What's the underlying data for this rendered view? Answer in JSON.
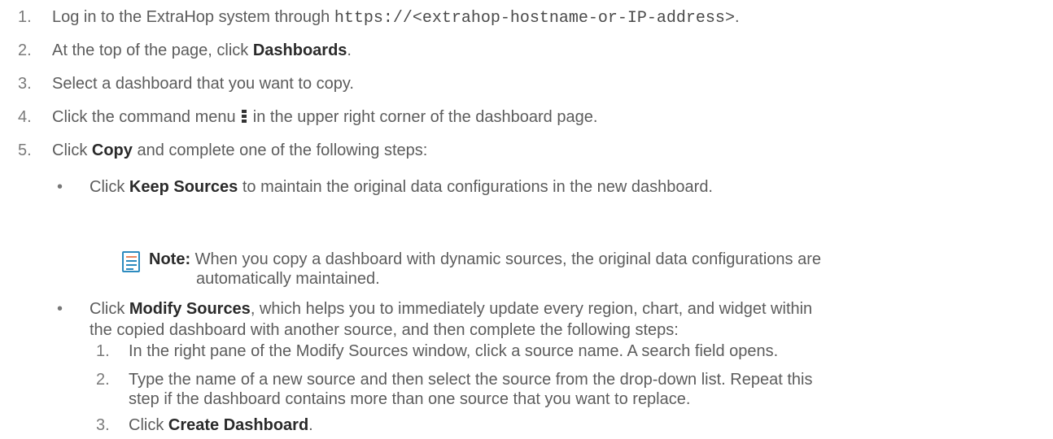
{
  "steps": [
    {
      "num": "1.",
      "pre": "Log in to the ExtraHop system through ",
      "code": "https://<extrahop-hostname-or-IP-address>",
      "post": "."
    },
    {
      "num": "2.",
      "pre": "At the top of the page, click ",
      "bold": "Dashboards",
      "post": "."
    },
    {
      "num": "3.",
      "text": "Select a dashboard that you want to copy."
    },
    {
      "num": "4.",
      "pre": "Click the command menu ",
      "post": " in the upper right corner of the dashboard page."
    },
    {
      "num": "5.",
      "pre": "Click ",
      "bold": "Copy",
      "post": " and complete one of the following steps:"
    }
  ],
  "bullets": {
    "keep": {
      "pre": "Click ",
      "bold": "Keep Sources",
      "post": " to maintain the original data configurations in the new dashboard."
    },
    "note": {
      "label": "Note:",
      "line1": " When you copy a dashboard with dynamic sources, the original data configurations are",
      "line2": "automatically maintained."
    },
    "modify": {
      "pre": "Click ",
      "bold": "Modify Sources",
      "post": ", which helps you to immediately update every region, chart, and widget within",
      "line2": "the copied dashboard with another source, and then complete the following steps:"
    }
  },
  "substeps": [
    {
      "num": "1.",
      "text": "In the right pane of the Modify Sources window, click a source name. A search field opens."
    },
    {
      "num": "2.",
      "line1": "Type the name of a new source and then select the source from the drop-down list. Repeat this",
      "line2": "step if the dashboard contains more than one source that you want to replace."
    },
    {
      "num": "3.",
      "pre": "Click ",
      "bold": "Create Dashboard",
      "post": "."
    }
  ]
}
